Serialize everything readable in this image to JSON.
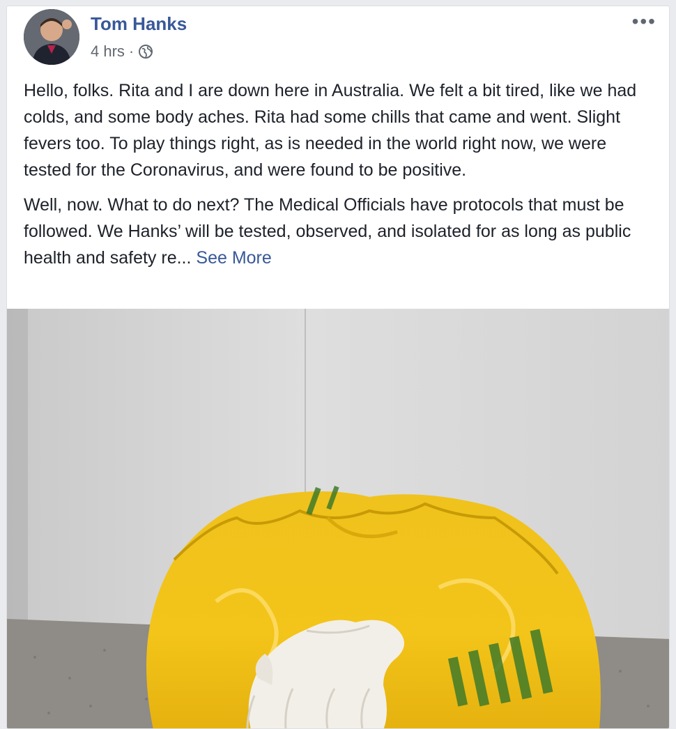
{
  "post": {
    "author": "Tom Hanks",
    "time": "4 hrs",
    "separator": "·",
    "privacy_icon": "globe-icon",
    "more_icon": "more-options-icon",
    "more_label": "•••",
    "paragraphs": [
      "Hello, folks. Rita and I are down here in Australia. We felt a bit tired, like we had colds, and some body aches. Rita had some chills that came and went. Slight fevers too. To play things right, as is needed in the world right now, we were tested for the Coronavirus, and were found to be positive.",
      "Well, now. What to do next? The Medical Officials have protocols that must be followed. We Hanks’ will be tested, observed, and isolated for as long as public health and safety re..."
    ],
    "see_more": "See More"
  },
  "colors": {
    "link": "#385898",
    "text": "#1d2129",
    "meta": "#606770",
    "bag": "#f2c219",
    "wall": "#dcdcdc"
  }
}
